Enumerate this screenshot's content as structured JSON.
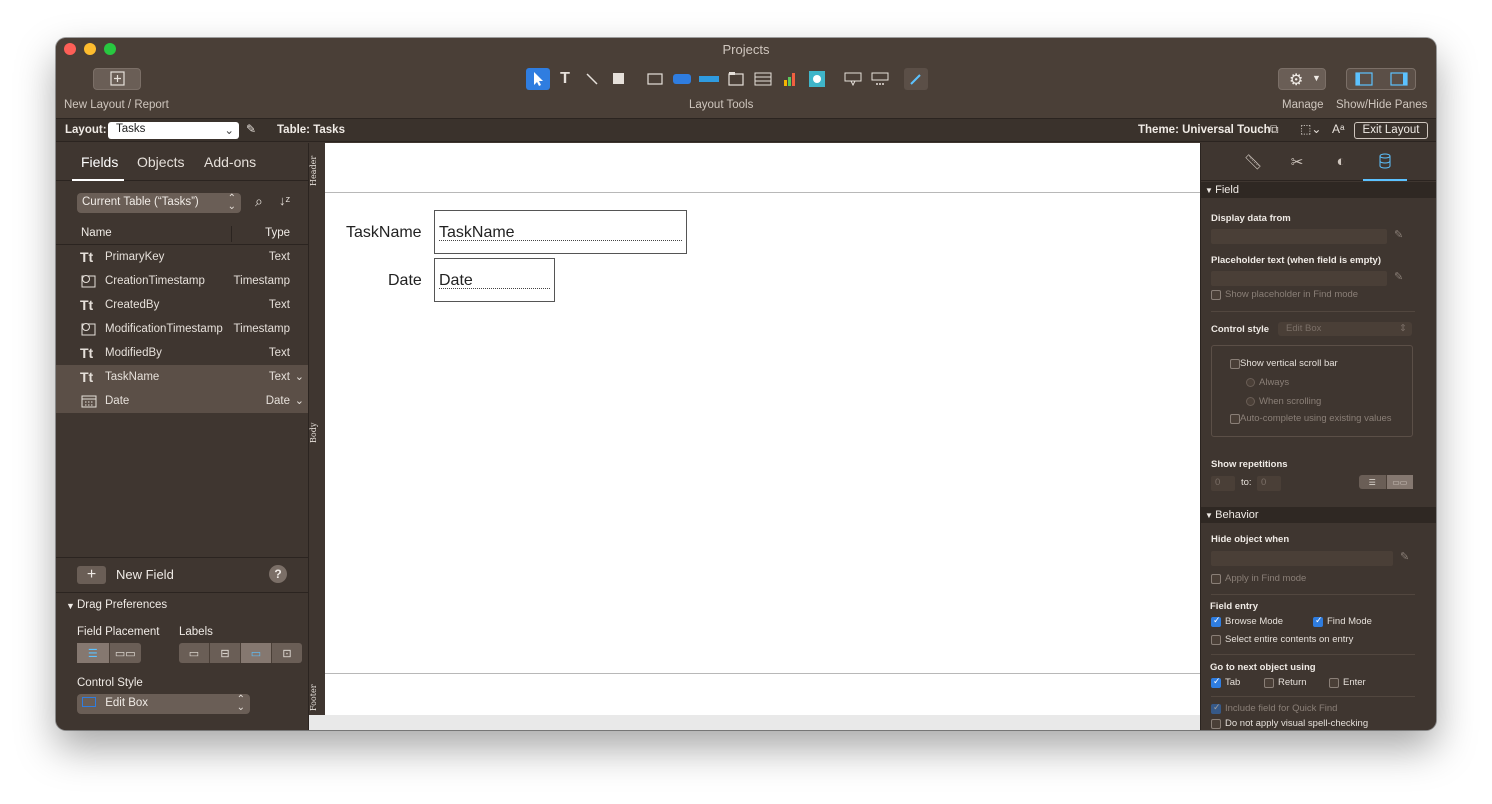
{
  "window": {
    "title": "Projects"
  },
  "toolbar": {
    "new_layout_label": "New Layout / Report",
    "layout_tools_label": "Layout Tools",
    "manage_label": "Manage",
    "show_hide_label": "Show/Hide Panes"
  },
  "layoutbar": {
    "layout_label": "Layout:",
    "layout_value": "Tasks",
    "table_label": "Table: Tasks",
    "theme_label": "Theme: Universal Touch",
    "exit_label": "Exit Layout"
  },
  "leftpane": {
    "tabs": [
      "Fields",
      "Objects",
      "Add-ons"
    ],
    "table_select": "Current Table (“Tasks”)",
    "col_name": "Name",
    "col_type": "Type",
    "fields": [
      {
        "name": "PrimaryKey",
        "type": "Text",
        "icon": "text-field-icon"
      },
      {
        "name": "CreationTimestamp",
        "type": "Timestamp",
        "icon": "timestamp-field-icon"
      },
      {
        "name": "CreatedBy",
        "type": "Text",
        "icon": "text-field-icon"
      },
      {
        "name": "ModificationTimestamp",
        "type": "Timestamp",
        "icon": "timestamp-field-icon"
      },
      {
        "name": "ModifiedBy",
        "type": "Text",
        "icon": "text-field-icon"
      },
      {
        "name": "TaskName",
        "type": "Text",
        "icon": "text-field-icon"
      },
      {
        "name": "Date",
        "type": "Date",
        "icon": "date-field-icon"
      }
    ],
    "new_field_label": "New Field",
    "help_label": "?",
    "drag_prefs_label": "Drag Preferences",
    "field_placement_label": "Field Placement",
    "labels_label": "Labels",
    "control_style_label": "Control Style",
    "control_style_value": "Edit Box"
  },
  "canvas": {
    "parts": [
      "Header",
      "Body",
      "Footer"
    ],
    "fields": [
      {
        "label": "TaskName",
        "value": "TaskName"
      },
      {
        "label": "Date",
        "value": "Date"
      }
    ]
  },
  "inspector": {
    "field_section": "Field",
    "display_data_from": "Display data from",
    "placeholder_label": "Placeholder text (when field is empty)",
    "show_placeholder": "Show placeholder in Find mode",
    "control_style_label": "Control style",
    "control_style_value": "Edit Box",
    "show_scroll": "Show vertical scroll bar",
    "always": "Always",
    "when_scrolling": "When scrolling",
    "auto_complete": "Auto-complete using existing values",
    "show_repetitions": "Show repetitions",
    "rep_from": "0",
    "rep_to_label": "to:",
    "rep_to": "0",
    "behavior_section": "Behavior",
    "hide_object_when": "Hide object when",
    "apply_find": "Apply in Find mode",
    "field_entry": "Field entry",
    "browse_mode": "Browse Mode",
    "find_mode": "Find Mode",
    "select_entire": "Select entire contents on entry",
    "go_next": "Go to next object using",
    "tab": "Tab",
    "return": "Return",
    "enter": "Enter",
    "include_quick_find": "Include field for Quick Find",
    "no_spell": "Do not apply visual spell-checking"
  },
  "colors": {
    "accent": "#2f7de0",
    "highlight": "#5cc2ff",
    "window_bg": "#3f3630"
  }
}
